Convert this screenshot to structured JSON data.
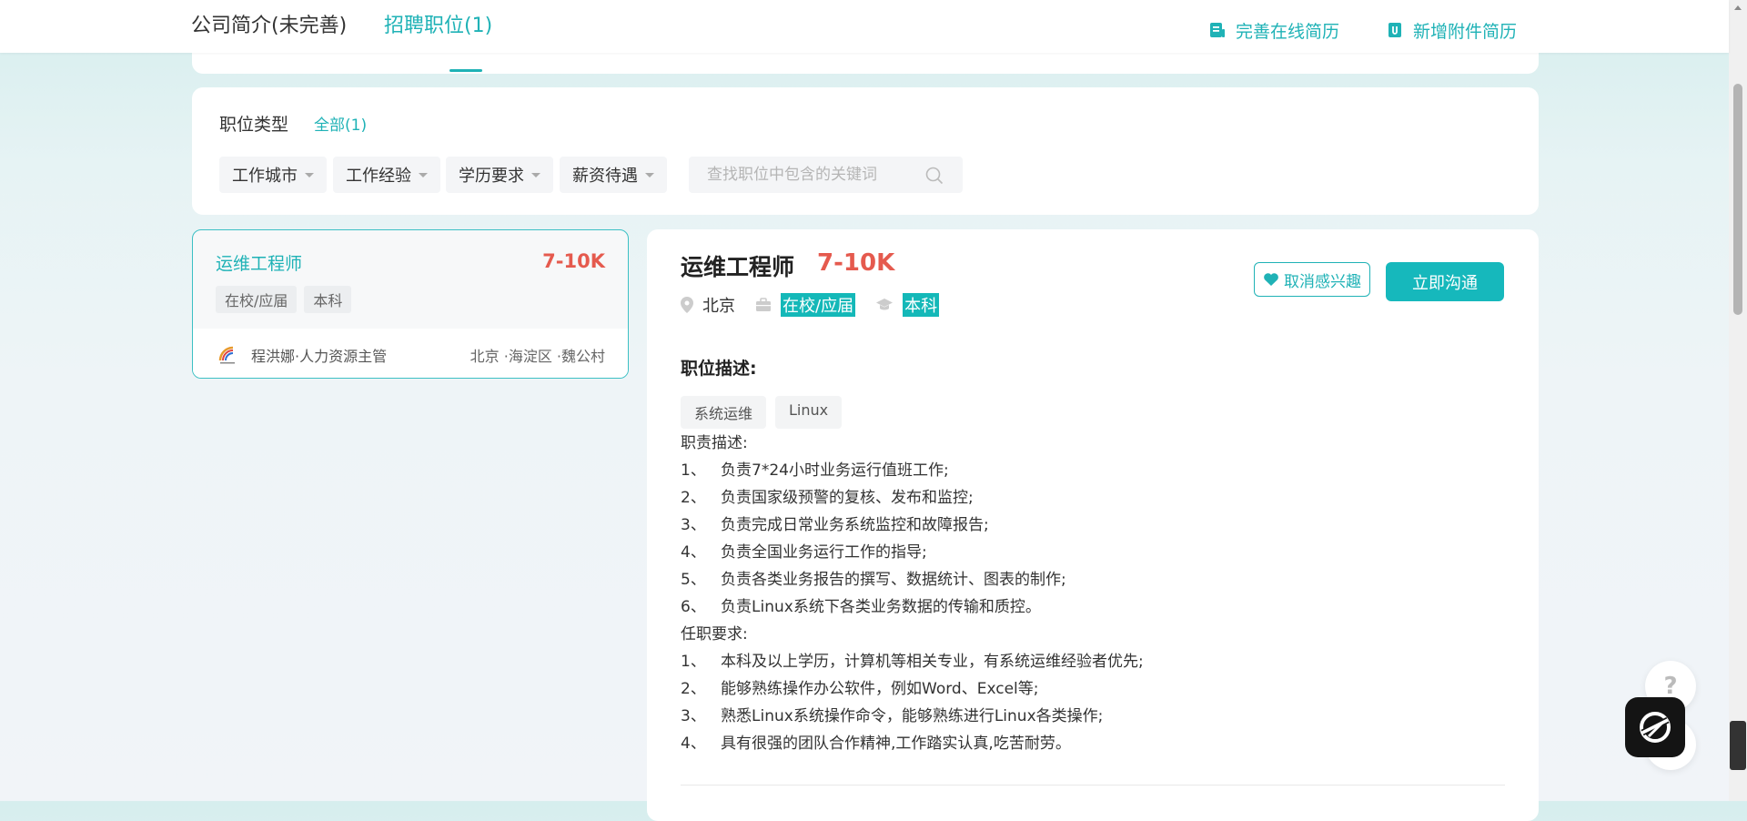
{
  "header": {
    "tab_intro": "公司简介(未完善)",
    "tab_jobs": "招聘职位(1)",
    "action_online_resume": "完善在线简历",
    "action_attach_resume": "新增附件简历"
  },
  "filters": {
    "type_label": "职位类型",
    "type_all": "全部(1)",
    "dropdowns": [
      "工作城市",
      "工作经验",
      "学历要求",
      "薪资待遇"
    ],
    "search_placeholder": "查找职位中包含的关键词"
  },
  "job_list": [
    {
      "title": "运维工程师",
      "salary": "7-10K",
      "tags": [
        "在校/应届",
        "本科"
      ],
      "recruiter": "程洪娜·人力资源主管",
      "location": "北京 ·海淀区 ·魏公村"
    }
  ],
  "detail": {
    "title": "运维工程师",
    "salary": "7-10K",
    "city": "北京",
    "experience": "在校/应届",
    "education": "本科",
    "btn_fav": "取消感兴趣",
    "btn_chat": "立即沟通",
    "section_title": "职位描述:",
    "skills": [
      "系统运维",
      "Linux"
    ],
    "description_lines": [
      "职责描述:",
      "1、   负责7*24小时业务运行值班工作;",
      "2、   负责国家级预警的复核、发布和监控;",
      "3、   负责完成日常业务系统监控和故障报告;",
      "4、   负责全国业务运行工作的指导;",
      "5、   负责各类业务报告的撰写、数据统计、图表的制作;",
      "6、   负责Linux系统下各类业务数据的传输和质控。",
      "任职要求:",
      "1、   本科及以上学历，计算机等相关专业，有系统运维经验者优先;",
      "2、   能够熟练操作办公软件，例如Word、Excel等;",
      "3、   熟悉Linux系统操作命令，能够熟练进行Linux各类操作;",
      "4、   具有很强的团队合作精神,工作踏实认真,吃苦耐劳。"
    ]
  },
  "widgets": {
    "help_glyph": "?"
  },
  "colors": {
    "accent": "#1fb2b6",
    "salary": "#e55a4e",
    "highlight": "#14b8b8"
  }
}
